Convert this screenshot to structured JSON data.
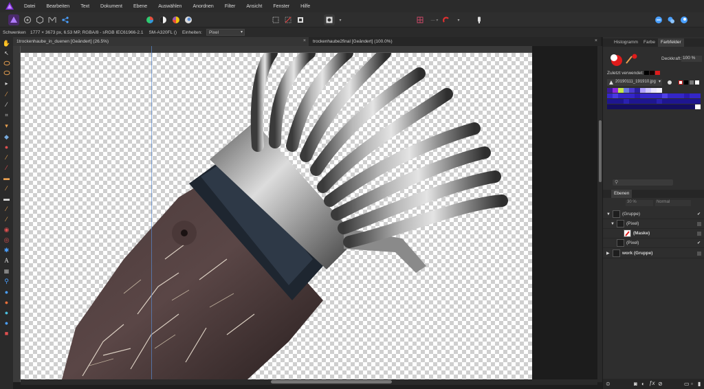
{
  "menu": {
    "items": [
      "Datei",
      "Bearbeiten",
      "Text",
      "Dokument",
      "Ebene",
      "Auswählen",
      "Anordnen",
      "Filter",
      "Ansicht",
      "Fenster",
      "Hilfe"
    ]
  },
  "context": {
    "tool_name": "Schwenken",
    "doc_info": "1777 × 3673 px, 6.53 MP, RGBA/8 - sRGB IEC61966-2.1",
    "profile": "SM-A320FL ()",
    "units_label": "Einheiten:",
    "units_value": "Pixel"
  },
  "tabs": [
    {
      "label": "1trockenhaube_in_duenen [Geändert] (26.5%)",
      "close": "×"
    },
    {
      "label": "trockenhaube2final [Geändert] (100.0%)",
      "close": "×"
    }
  ],
  "swatches_panel": {
    "tabs": [
      "Histogramm",
      "Farbe",
      "Farbfelder"
    ],
    "opacity_label": "Deckkraft:",
    "opacity_value": "100 %",
    "recent_label": "Zuletzt verwendet:",
    "palette_name": "20190111_191910.jpg"
  },
  "layers_panel": {
    "tab": "Ebenen",
    "opacity_value": "30 %",
    "blend_mode": "Normal",
    "layers": [
      {
        "name": "(Gruppe)",
        "checked": true
      },
      {
        "name": "(Pixel)",
        "checked": false
      },
      {
        "name": "(Maske)",
        "checked": false
      },
      {
        "name": "(Pixel)",
        "checked": true
      },
      {
        "name": "work (Gruppe)",
        "checked": false
      }
    ]
  },
  "colors": {
    "accent": "#7d2bd6",
    "primary_color": "#e01b1b",
    "guide": "#5a8ad0"
  }
}
